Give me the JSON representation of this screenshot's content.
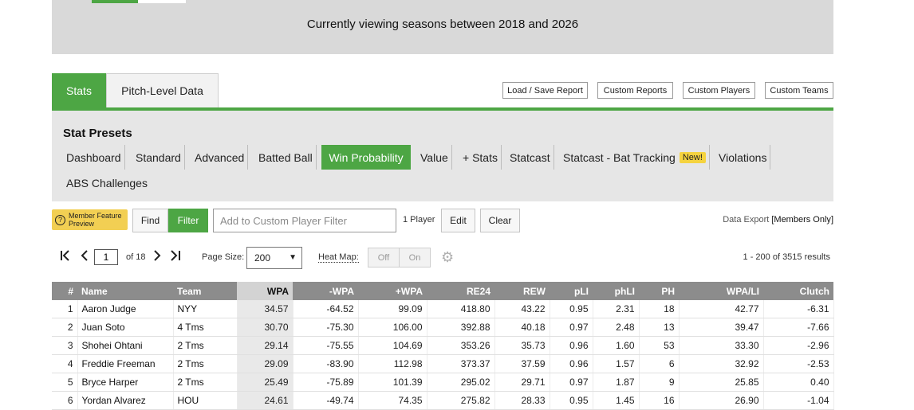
{
  "banner": {
    "text": "Currently viewing seasons between 2018 and 2026"
  },
  "tabs": [
    {
      "label": "Stats"
    },
    {
      "label": "Pitch-Level Data"
    }
  ],
  "report_buttons": [
    {
      "label": "Load / Save Report"
    },
    {
      "label": "Custom Reports"
    },
    {
      "label": "Custom Players"
    },
    {
      "label": "Custom Teams"
    }
  ],
  "presets": {
    "title": "Stat Presets",
    "items": [
      {
        "label": "Dashboard"
      },
      {
        "label": "Standard"
      },
      {
        "label": "Advanced"
      },
      {
        "label": "Batted Ball"
      },
      {
        "label": "Win Probability"
      },
      {
        "label": "Value"
      },
      {
        "label": "+ Stats"
      },
      {
        "label": "Statcast"
      },
      {
        "label": "Statcast - Bat Tracking"
      },
      {
        "label": "Violations"
      },
      {
        "label": "ABS Challenges"
      }
    ],
    "new_badge": "New!",
    "active": "Win Probability"
  },
  "filter": {
    "member_badge": "Member Feature Preview",
    "member_badge_line1": "Member Feature",
    "member_badge_line2": "Preview",
    "help_glyph": "?",
    "find_label": "Find",
    "filter_label": "Filter",
    "input_placeholder": "Add to Custom Player Filter",
    "player_count": "1 Player",
    "edit_label": "Edit",
    "clear_label": "Clear",
    "export_prefix": "Data Export ",
    "export_bracket_open": "[",
    "export_members": "Members Only",
    "export_bracket_close": "]"
  },
  "pager": {
    "first_icon": "first-page-icon",
    "prev_icon": "prev-page-icon",
    "next_icon": "next-page-icon",
    "last_icon": "last-page-icon",
    "current_page": "1",
    "of_text": "of 18",
    "page_size_label": "Page Size:",
    "page_size": "200",
    "heat_map_label": "Heat Map:",
    "heat_off": "Off",
    "heat_on": "On",
    "results_text": "1 - 200 of 3515 results"
  },
  "table": {
    "columns": [
      "#",
      "Name",
      "Team",
      "WPA",
      "-WPA",
      "+WPA",
      "RE24",
      "REW",
      "pLI",
      "phLI",
      "PH",
      "WPA/LI",
      "Clutch"
    ],
    "sorted_column": "WPA",
    "rows": [
      [
        "1",
        "Aaron Judge",
        "NYY",
        "34.57",
        "-64.52",
        "99.09",
        "418.80",
        "43.22",
        "0.95",
        "2.31",
        "18",
        "42.77",
        "-6.31"
      ],
      [
        "2",
        "Juan Soto",
        "4 Tms",
        "30.70",
        "-75.30",
        "106.00",
        "392.88",
        "40.18",
        "0.97",
        "2.48",
        "13",
        "39.47",
        "-7.66"
      ],
      [
        "3",
        "Shohei Ohtani",
        "2 Tms",
        "29.14",
        "-75.55",
        "104.69",
        "353.26",
        "35.73",
        "0.96",
        "1.60",
        "53",
        "33.30",
        "-2.96"
      ],
      [
        "4",
        "Freddie Freeman",
        "2 Tms",
        "29.09",
        "-83.90",
        "112.98",
        "373.37",
        "37.59",
        "0.96",
        "1.57",
        "6",
        "32.92",
        "-2.53"
      ],
      [
        "5",
        "Bryce Harper",
        "2 Tms",
        "25.49",
        "-75.89",
        "101.39",
        "295.02",
        "29.71",
        "0.97",
        "1.87",
        "9",
        "25.85",
        "0.40"
      ],
      [
        "6",
        "Yordan Alvarez",
        "HOU",
        "24.61",
        "-49.74",
        "74.35",
        "275.82",
        "28.33",
        "0.95",
        "1.45",
        "16",
        "26.90",
        "-1.04"
      ]
    ]
  },
  "colors": {
    "accent_green": "#4da644",
    "header_gray": "#8c8c8c",
    "badge_yellow": "#f2cf53"
  }
}
